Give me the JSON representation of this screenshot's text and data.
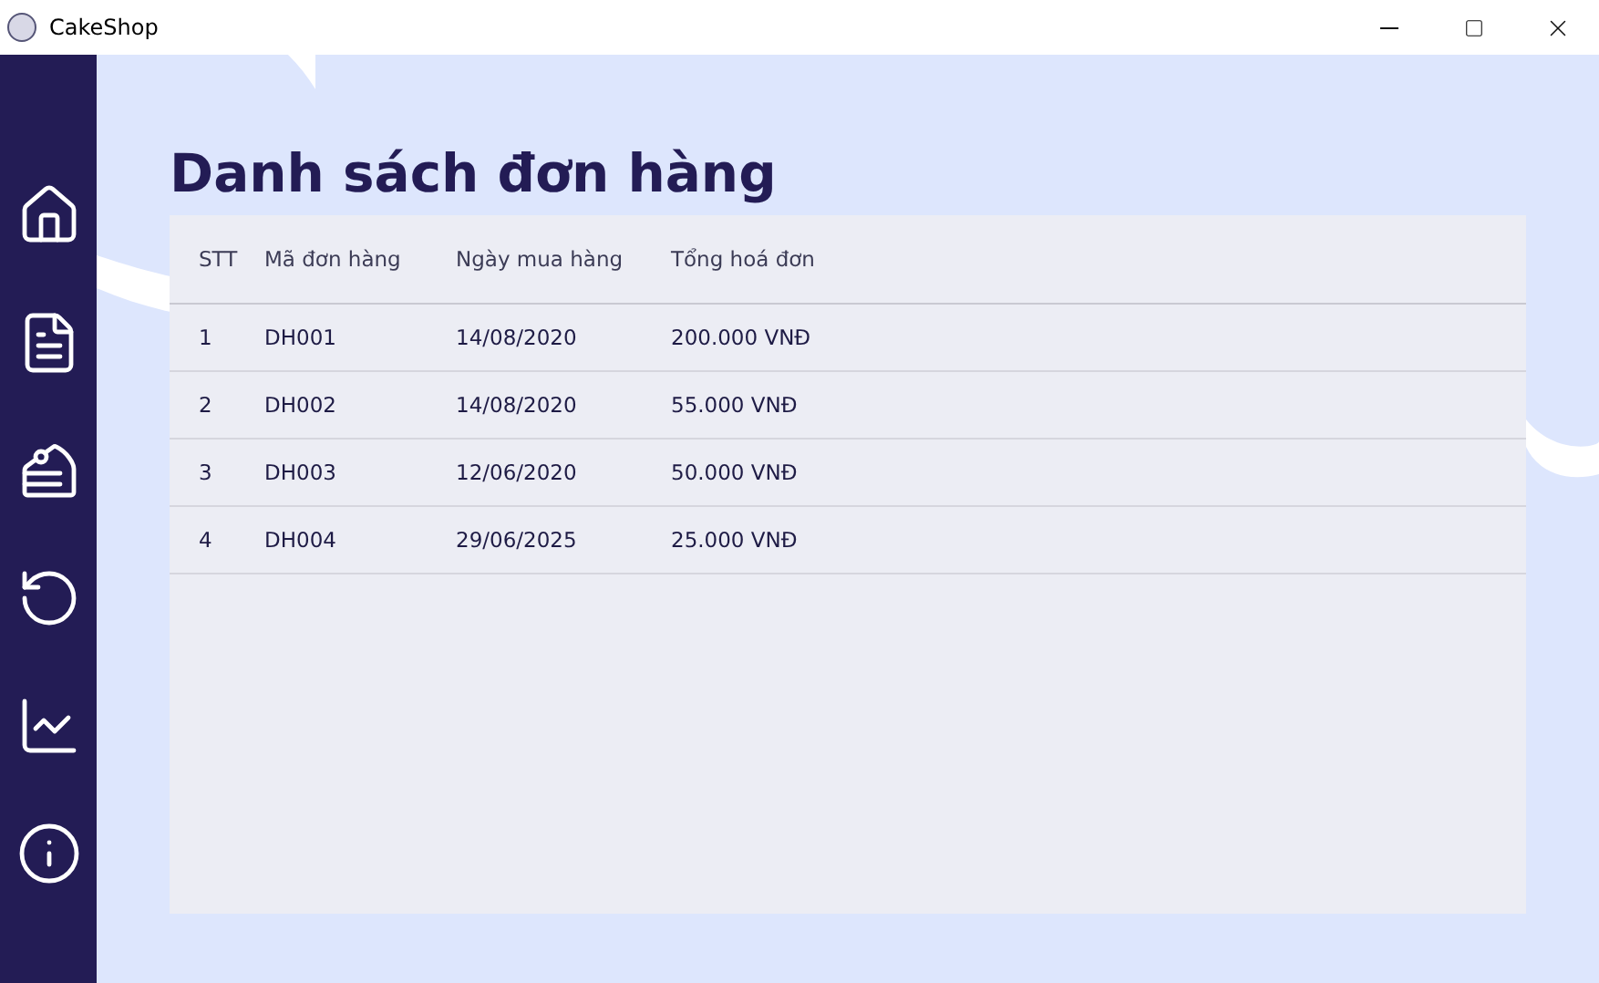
{
  "window": {
    "title": "CakeShop"
  },
  "page": {
    "title": "Danh sách đơn hàng"
  },
  "table": {
    "columns": [
      "STT",
      "Mã đơn hàng",
      "Ngày mua hàng",
      "Tổng hoá đơn"
    ],
    "rows": [
      [
        "1",
        "DH001",
        "14/08/2020",
        "200.000 VNĐ"
      ],
      [
        "2",
        "DH002",
        "14/08/2020",
        "55.000 VNĐ"
      ],
      [
        "3",
        "DH003",
        "12/06/2020",
        "50.000 VNĐ"
      ],
      [
        "4",
        "DH004",
        "29/06/2025",
        "25.000 VNĐ"
      ]
    ]
  }
}
